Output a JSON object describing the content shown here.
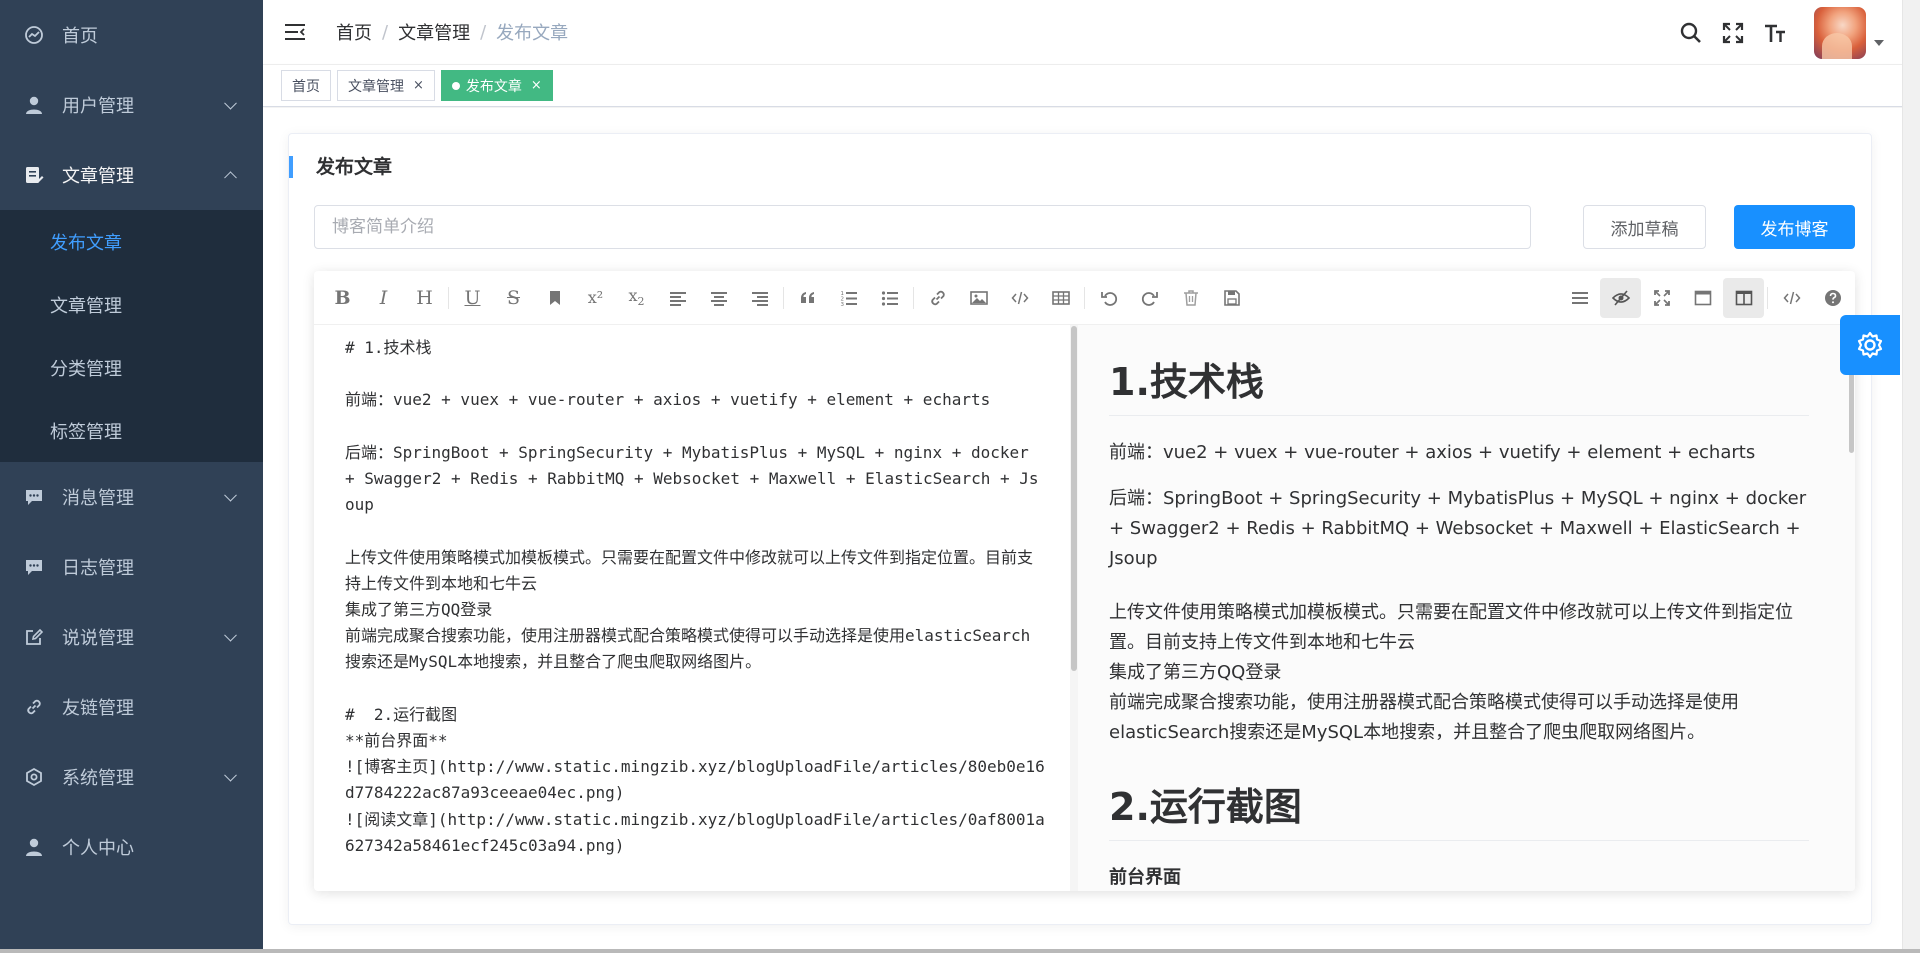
{
  "sidebar": {
    "items": [
      {
        "label": "首页",
        "icon": "dashboard-icon"
      },
      {
        "label": "用户管理",
        "icon": "user-icon"
      },
      {
        "label": "文章管理",
        "icon": "article-icon"
      },
      {
        "label": "消息管理",
        "icon": "message-icon"
      },
      {
        "label": "日志管理",
        "icon": "log-icon"
      },
      {
        "label": "说说管理",
        "icon": "edit-icon"
      },
      {
        "label": "友链管理",
        "icon": "link-icon"
      },
      {
        "label": "系统管理",
        "icon": "system-icon"
      },
      {
        "label": "个人中心",
        "icon": "user-icon"
      }
    ],
    "article_sub": [
      "发布文章",
      "文章管理",
      "分类管理",
      "标签管理"
    ]
  },
  "header": {
    "breadcrumb": [
      "首页",
      "文章管理",
      "发布文章"
    ],
    "separator": "/"
  },
  "tags": [
    {
      "label": "首页"
    },
    {
      "label": "文章管理",
      "close": "×"
    },
    {
      "label": "发布文章",
      "close": "×"
    }
  ],
  "card": {
    "title": "发布文章",
    "intro_placeholder": "博客简单介绍",
    "draft_label": "添加草稿",
    "publish_label": "发布博客"
  },
  "toolbar": {
    "bold": "B",
    "italic": "I",
    "heading": "H",
    "underline": "U",
    "strike": "S",
    "sup": "x²",
    "sub_base": "x",
    "sub_index": "2"
  },
  "editor": {
    "source": "# 1.技术栈\n\n前端：vue2 + vuex + vue-router + axios + vuetify + element + echarts\n\n后端：SpringBoot + SpringSecurity + MybatisPlus + MySQL + nginx + docker + Swagger2 + Redis + RabbitMQ + Websocket + Maxwell + ElasticSearch + Jsoup\n\n上传文件使用策略模式加模板模式。只需要在配置文件中修改就可以上传文件到指定位置。目前支持上传文件到本地和七牛云\n集成了第三方QQ登录\n前端完成聚合搜索功能，使用注册器模式配合策略模式使得可以手动选择是使用elasticSearch搜索还是MySQL本地搜索，并且整合了爬虫爬取网络图片。\n\n#  2.运行截图\n**前台界面**\n![博客主页](http://www.static.mingzib.xyz/blogUploadFile/articles/80eb0e16d7784222ac87a93ceeae04ec.png)\n![阅读文章](http://www.static.mingzib.xyz/blogUploadFile/articles/0af8001a627342a58461ecf245c03a94.png)",
    "preview": {
      "h1_1": "1.技术栈",
      "p_front": "前端：vue2 + vuex + vue-router + axios + vuetify + element + echarts",
      "p_back": "后端：SpringBoot + SpringSecurity + MybatisPlus + MySQL + nginx + docker + Swagger2 + Redis + RabbitMQ + Websocket + Maxwell + ElasticSearch + Jsoup",
      "p_upload": "上传文件使用策略模式加模板模式。只需要在配置文件中修改就可以上传文件到指定位置。目前支持上传文件到本地和七牛云",
      "p_qq": "集成了第三方QQ登录",
      "p_search": "前端完成聚合搜索功能，使用注册器模式配合策略模式使得可以手动选择是使用elasticSearch搜索还是MySQL本地搜索，并且整合了爬虫爬取网络图片。",
      "h1_2": "2.运行截图",
      "bold_line": "前台界面"
    }
  },
  "colors": {
    "sidebar_bg": "#304156",
    "submenu_bg": "#1f2d3d",
    "active": "#409eff",
    "tag_active": "#42b983",
    "primary": "#1890ff"
  }
}
